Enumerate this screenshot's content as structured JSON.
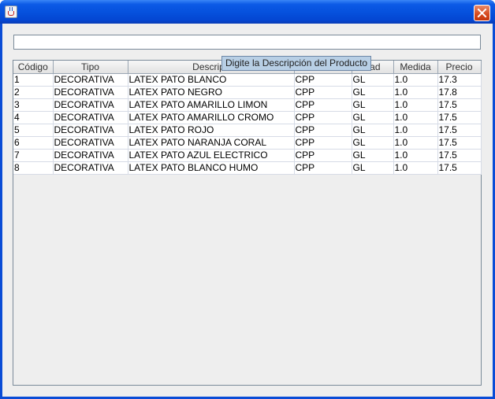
{
  "window": {
    "title": ""
  },
  "search": {
    "value": "",
    "placeholder": ""
  },
  "tooltip": {
    "text": "Digite la Descripción del Producto"
  },
  "table": {
    "columns": [
      "Código",
      "Tipo",
      "Descripción",
      "Unidad",
      "Medida",
      "Precio"
    ],
    "header_visible": [
      "Código",
      "Tipo",
      "Descripc",
      "",
      "dad",
      "Medida",
      "Precio"
    ],
    "rows": [
      [
        "1",
        "DECORATIVA",
        "LATEX PATO BLANCO",
        "CPP",
        "GL",
        "1.0",
        "17.3"
      ],
      [
        "2",
        "DECORATIVA",
        "LATEX PATO NEGRO",
        "CPP",
        "GL",
        "1.0",
        "17.8"
      ],
      [
        "3",
        "DECORATIVA",
        "LATEX PATO AMARILLO LIMON",
        "CPP",
        "GL",
        "1.0",
        "17.5"
      ],
      [
        "4",
        "DECORATIVA",
        "LATEX PATO AMARILLO CROMO",
        "CPP",
        "GL",
        "1.0",
        "17.5"
      ],
      [
        "5",
        "DECORATIVA",
        "LATEX PATO ROJO",
        "CPP",
        "GL",
        "1.0",
        "17.5"
      ],
      [
        "6",
        "DECORATIVA",
        "LATEX PATO NARANJA CORAL",
        "CPP",
        "GL",
        "1.0",
        "17.5"
      ],
      [
        "7",
        "DECORATIVA",
        "LATEX PATO AZUL ELECTRICO",
        "CPP",
        "GL",
        "1.0",
        "17.5"
      ],
      [
        "8",
        "DECORATIVA",
        "LATEX PATO BLANCO HUMO",
        "CPP",
        "GL",
        "1.0",
        "17.5"
      ]
    ]
  },
  "icons": {
    "app": "java-cup-icon",
    "close": "close-icon"
  },
  "colors": {
    "titlebar": "#0550dc",
    "close": "#d6491c",
    "tooltip_bg": "#b8cfe5"
  }
}
